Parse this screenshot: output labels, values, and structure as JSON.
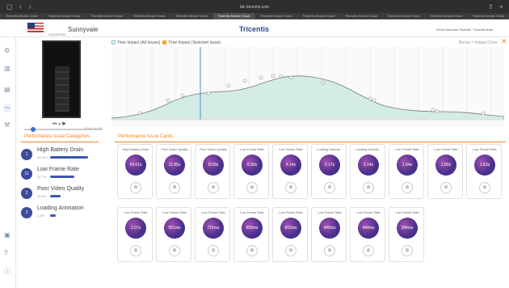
{
  "browser": {
    "url": "tdc.tricentis.com",
    "tab_label": "Tricentis Device Cloud",
    "tab_count": 12
  },
  "header": {
    "location": "Sunnyvale",
    "carrier": "UNKNOWN",
    "logo": "Tricentis",
    "user": "Kevin Hancock  Tricentis / Tricentis Adm"
  },
  "legend": {
    "all": "Time Impact (All Issues)",
    "selected": "Time Impact (Selected Issue)"
  },
  "burst": "Bursty = Impact Zone",
  "timeline": "00:00:14:133",
  "sections": {
    "categories": "Performance Issue Categories",
    "cards": "Performance Issue Cards"
  },
  "categories": [
    {
      "count": "1",
      "name": "High Battery Drain",
      "pct": "54.01%",
      "frac": 0.54
    },
    {
      "count": "11",
      "name": "Low Frame Rate",
      "pct": "31.7%",
      "frac": 0.32
    },
    {
      "count": "2",
      "name": "Poor Video Quality",
      "pct": "10.9%",
      "frac": 0.11
    },
    {
      "count": "2",
      "name": "Loading Animation",
      "pct": "4.3%",
      "frac": 0.04
    }
  ],
  "cards": [
    {
      "title": "High Battery Drain",
      "value": "54.01s"
    },
    {
      "title": "Poor Video Quality",
      "value": "11.85s"
    },
    {
      "title": "Poor Video Quality",
      "value": "8.09s"
    },
    {
      "title": "Low Frame Rate",
      "value": "6.90s"
    },
    {
      "title": "Low Frame Rate",
      "value": "4.14s"
    },
    {
      "title": "Loading Animati...",
      "value": "2.17s"
    },
    {
      "title": "Loading Animati...",
      "value": "2.14s"
    },
    {
      "title": "Low Frame Rate",
      "value": "1.94s"
    },
    {
      "title": "Low Frame Rate",
      "value": "1.80s"
    },
    {
      "title": "Low Frame Rate",
      "value": "1.63s"
    },
    {
      "title": "Low Frame Rate",
      "value": "1.07s"
    },
    {
      "title": "Low Frame Rate",
      "value": "951ms"
    },
    {
      "title": "Low Frame Rate",
      "value": "716ms"
    },
    {
      "title": "Low Frame Rate",
      "value": "699ms"
    },
    {
      "title": "Low Frame Rate",
      "value": "603ms"
    },
    {
      "title": "Low Frame Rate",
      "value": "445ms"
    },
    {
      "title": "Low Frame Rate",
      "value": "444ms"
    },
    {
      "title": "Low Frame Rate",
      "value": "394ms"
    }
  ],
  "colors": {
    "accent": "#f5811f",
    "brand": "#2c4a8c"
  }
}
